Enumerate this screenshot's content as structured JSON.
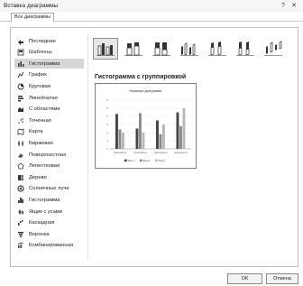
{
  "window": {
    "title": "Вставка диаграммы",
    "help": "?",
    "close": "✕"
  },
  "tabs": {
    "all_charts": "Все диаграммы"
  },
  "sidebar": {
    "items": [
      {
        "label": "Последние",
        "icon": "recent-icon"
      },
      {
        "label": "Шаблоны",
        "icon": "templates-icon"
      },
      {
        "label": "Гистограмма",
        "icon": "column-chart-icon",
        "selected": true
      },
      {
        "label": "График",
        "icon": "line-chart-icon"
      },
      {
        "label": "Круговая",
        "icon": "pie-chart-icon"
      },
      {
        "label": "Линейчатая",
        "icon": "bar-chart-icon"
      },
      {
        "label": "С областями",
        "icon": "area-chart-icon"
      },
      {
        "label": "Точечная",
        "icon": "scatter-chart-icon"
      },
      {
        "label": "Карта",
        "icon": "map-chart-icon"
      },
      {
        "label": "Биржевая",
        "icon": "stock-chart-icon"
      },
      {
        "label": "Поверхностная",
        "icon": "surface-chart-icon"
      },
      {
        "label": "Лепестковая",
        "icon": "radar-chart-icon"
      },
      {
        "label": "Дерево",
        "icon": "treemap-chart-icon"
      },
      {
        "label": "Солнечные лучи",
        "icon": "sunburst-chart-icon"
      },
      {
        "label": "Гистограмма",
        "icon": "histogram-chart-icon"
      },
      {
        "label": "Ящик с усами",
        "icon": "box-whisker-chart-icon"
      },
      {
        "label": "Каскадная",
        "icon": "waterfall-chart-icon"
      },
      {
        "label": "Воронка",
        "icon": "funnel-chart-icon"
      },
      {
        "label": "Комбинированная",
        "icon": "combo-chart-icon"
      }
    ]
  },
  "subtypes": {
    "heading": "Гистограмма с группировкой",
    "items": [
      {
        "name": "clustered-column",
        "selected": true
      },
      {
        "name": "stacked-column"
      },
      {
        "name": "percent-stacked-column"
      },
      {
        "name": "3d-clustered-column"
      },
      {
        "name": "3d-stacked-column"
      },
      {
        "name": "3d-percent-stacked-column"
      },
      {
        "name": "3d-column"
      }
    ]
  },
  "preview": {
    "title": "Название диаграммы",
    "categories": [
      "Категория 1",
      "Категория 2",
      "Категория 3",
      "Категория 4"
    ],
    "series": [
      {
        "name": "Ряд 1",
        "values": [
          4.3,
          2.5,
          3.5,
          4.5
        ]
      },
      {
        "name": "Ряд 2",
        "values": [
          2.4,
          4.4,
          1.8,
          2.8
        ]
      },
      {
        "name": "Ряд 3",
        "values": [
          2,
          2,
          3,
          5
        ]
      }
    ],
    "yticks": [
      "6",
      "5",
      "4",
      "3",
      "2",
      "1",
      "0"
    ],
    "colors": [
      "#444444",
      "#8a8a8a",
      "#b8b8b8"
    ]
  },
  "buttons": {
    "ok": "ОК",
    "cancel": "Отмена"
  }
}
